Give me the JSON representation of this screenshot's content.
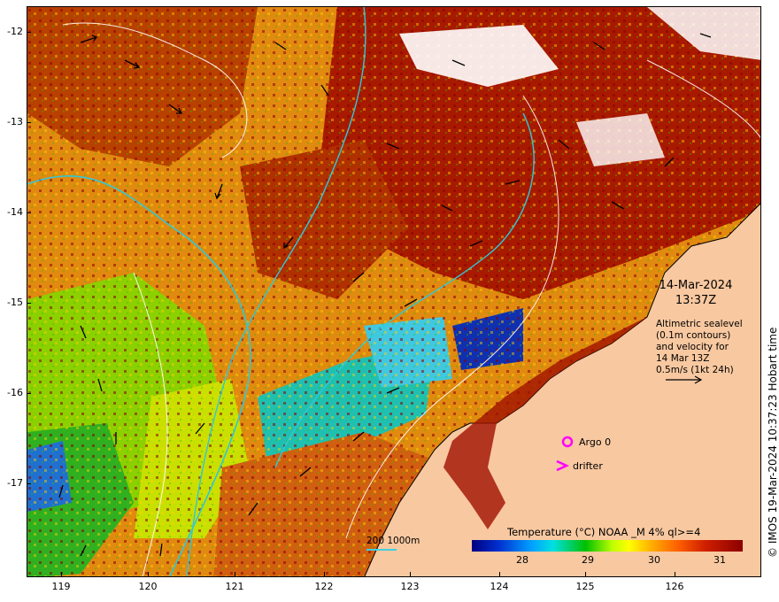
{
  "map": {
    "y_axis_labels": [
      "-12",
      "-13",
      "-14",
      "-15",
      "-16",
      "-17"
    ],
    "x_axis_labels": [
      "119",
      "120",
      "121",
      "122",
      "123",
      "124",
      "125",
      "126"
    ]
  },
  "info": {
    "date": "14-Mar-2024",
    "time": "13:37Z",
    "altimetry_lines": [
      "Altimetric sealevel",
      "(0.1m contours)",
      "and velocity for",
      "14 Mar 13Z",
      "0.5m/s (1kt 24h)"
    ]
  },
  "legend": {
    "argo_label": "Argo 0",
    "drifter_label": "drifter",
    "contour_label": "200  1000m"
  },
  "colorbar": {
    "title": "Temperature (°C) NOAA _M 4% ql>=4",
    "ticks": [
      "28",
      "29",
      "30",
      "31"
    ],
    "colors": [
      "#000080",
      "#00a0ff",
      "#00c000",
      "#ffff00",
      "#ff6000",
      "#8b0000"
    ]
  },
  "credit": "© IMOS 19-Mar-2024 10:37:23 Hobart time",
  "icons": {
    "argo": "argo-float-icon",
    "drifter": "drifter-icon",
    "scale_arrow": "velocity-scale-arrow-icon"
  }
}
